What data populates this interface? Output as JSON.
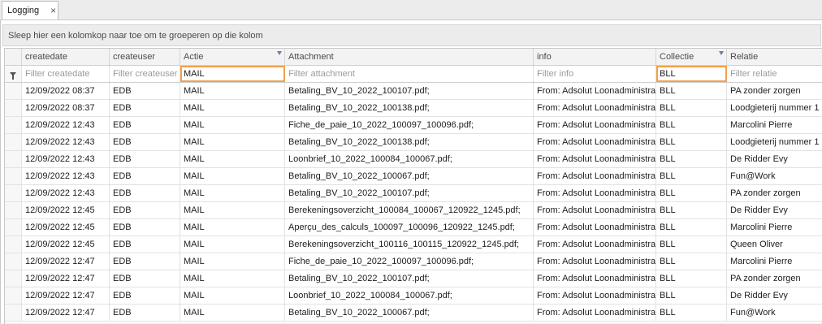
{
  "tab": {
    "label": "Logging",
    "close": "×"
  },
  "group_panel": {
    "text": "Sleep hier een kolomkop naar toe om te groeperen op die kolom"
  },
  "columns": [
    "createdate",
    "createuser",
    "Actie",
    "Attachment",
    "info",
    "Collectie",
    "Relatie"
  ],
  "filters": {
    "createdate": "Filter createdate",
    "createuser": "Filter createuser",
    "actie": "MAIL",
    "attachment": "Filter attachment",
    "info": "Filter info",
    "collectie": "BLL",
    "relatie": "Filter relatie"
  },
  "rows": [
    [
      "12/09/2022 08:37",
      "EDB",
      "MAIL",
      "Betaling_BV_10_2022_100107.pdf;",
      "From: Adsolut Loonadministratie",
      "BLL",
      "PA zonder zorgen"
    ],
    [
      "12/09/2022 08:37",
      "EDB",
      "MAIL",
      "Betaling_BV_10_2022_100138.pdf;",
      "From: Adsolut Loonadministratie",
      "BLL",
      "Loodgieterij nummer 1"
    ],
    [
      "12/09/2022 12:43",
      "EDB",
      "MAIL",
      "Fiche_de_paie_10_2022_100097_100096.pdf;",
      "From: Adsolut Loonadministratie",
      "BLL",
      "Marcolini Pierre"
    ],
    [
      "12/09/2022 12:43",
      "EDB",
      "MAIL",
      "Betaling_BV_10_2022_100138.pdf;",
      "From: Adsolut Loonadministratie",
      "BLL",
      "Loodgieterij nummer 1"
    ],
    [
      "12/09/2022 12:43",
      "EDB",
      "MAIL",
      "Loonbrief_10_2022_100084_100067.pdf;",
      "From: Adsolut Loonadministratie",
      "BLL",
      "De Ridder Evy"
    ],
    [
      "12/09/2022 12:43",
      "EDB",
      "MAIL",
      "Betaling_BV_10_2022_100067.pdf;",
      "From: Adsolut Loonadministratie",
      "BLL",
      "Fun@Work"
    ],
    [
      "12/09/2022 12:43",
      "EDB",
      "MAIL",
      "Betaling_BV_10_2022_100107.pdf;",
      "From: Adsolut Loonadministratie",
      "BLL",
      "PA zonder zorgen"
    ],
    [
      "12/09/2022 12:45",
      "EDB",
      "MAIL",
      "Berekeningsoverzicht_100084_100067_120922_1245.pdf;",
      "From: Adsolut Loonadministratie",
      "BLL",
      "De Ridder Evy"
    ],
    [
      "12/09/2022 12:45",
      "EDB",
      "MAIL",
      "Aperçu_des_calculs_100097_100096_120922_1245.pdf;",
      "From: Adsolut Loonadministratie",
      "BLL",
      "Marcolini Pierre"
    ],
    [
      "12/09/2022 12:45",
      "EDB",
      "MAIL",
      "Berekeningsoverzicht_100116_100115_120922_1245.pdf;",
      "From: Adsolut Loonadministratie",
      "BLL",
      "Queen Oliver"
    ],
    [
      "12/09/2022 12:47",
      "EDB",
      "MAIL",
      "Fiche_de_paie_10_2022_100097_100096.pdf;",
      "From: Adsolut Loonadministratie",
      "BLL",
      "Marcolini Pierre"
    ],
    [
      "12/09/2022 12:47",
      "EDB",
      "MAIL",
      "Betaling_BV_10_2022_100107.pdf;",
      "From: Adsolut Loonadministratie",
      "BLL",
      "PA zonder zorgen"
    ],
    [
      "12/09/2022 12:47",
      "EDB",
      "MAIL",
      "Loonbrief_10_2022_100084_100067.pdf;",
      "From: Adsolut Loonadministratie",
      "BLL",
      "De Ridder Evy"
    ],
    [
      "12/09/2022 12:47",
      "EDB",
      "MAIL",
      "Betaling_BV_10_2022_100067.pdf;",
      "From: Adsolut Loonadministratie",
      "BLL",
      "Fun@Work"
    ]
  ],
  "colors": {
    "active_filter_border": "#f0a14a",
    "sort_marker": "#6b7fa8"
  }
}
